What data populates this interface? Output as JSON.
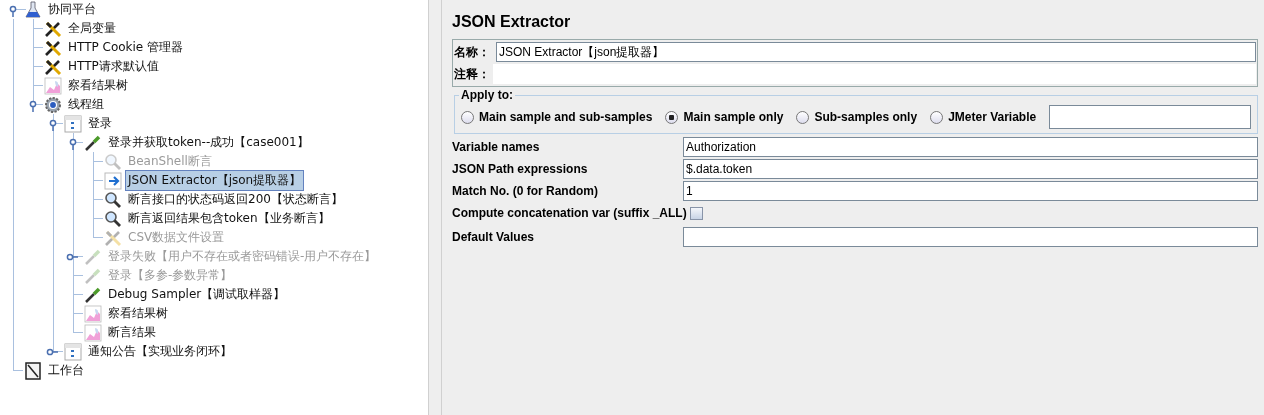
{
  "tree": [
    {
      "label": "协同平台",
      "kind": "testplan",
      "expanded": true,
      "disabled": false,
      "selected": false,
      "children": [
        {
          "label": "全局变量",
          "kind": "config",
          "disabled": false,
          "selected": false
        },
        {
          "label": "HTTP Cookie 管理器",
          "kind": "config",
          "disabled": false,
          "selected": false
        },
        {
          "label": "HTTP请求默认值",
          "kind": "config",
          "disabled": false,
          "selected": false
        },
        {
          "label": "察看结果树",
          "kind": "listener",
          "disabled": false,
          "selected": false
        },
        {
          "label": "线程组",
          "kind": "threadgroup",
          "expanded": true,
          "disabled": false,
          "selected": false,
          "children": [
            {
              "label": "登录",
              "kind": "controller",
              "expanded": true,
              "disabled": false,
              "selected": false,
              "children": [
                {
                  "label": "登录并获取token--成功【case001】",
                  "kind": "sampler",
                  "expanded": true,
                  "disabled": false,
                  "selected": false,
                  "children": [
                    {
                      "label": "BeanShell断言",
                      "kind": "assertion",
                      "disabled": true,
                      "selected": false
                    },
                    {
                      "label": "JSON Extractor【json提取器】",
                      "kind": "extractor",
                      "disabled": false,
                      "selected": true
                    },
                    {
                      "label": "断言接口的状态码返回200【状态断言】",
                      "kind": "assertion",
                      "disabled": false,
                      "selected": false
                    },
                    {
                      "label": "断言返回结果包含token【业务断言】",
                      "kind": "assertion",
                      "disabled": false,
                      "selected": false
                    },
                    {
                      "label": "CSV数据文件设置",
                      "kind": "config",
                      "disabled": true,
                      "selected": false
                    }
                  ]
                },
                {
                  "label": "登录失败【用户不存在或者密码错误-用户不存在】",
                  "kind": "sampler",
                  "expanded": false,
                  "disabled": true,
                  "selected": false
                },
                {
                  "label": "登录【多参-参数异常】",
                  "kind": "sampler",
                  "disabled": true,
                  "selected": false
                },
                {
                  "label": "Debug Sampler【调试取样器】",
                  "kind": "sampler",
                  "disabled": false,
                  "selected": false
                },
                {
                  "label": "察看结果树",
                  "kind": "listener",
                  "disabled": false,
                  "selected": false
                },
                {
                  "label": "断言结果",
                  "kind": "listener",
                  "disabled": false,
                  "selected": false
                }
              ]
            },
            {
              "label": "通知公告【实现业务闭环】",
              "kind": "controller",
              "expanded": false,
              "disabled": false,
              "selected": false
            }
          ]
        }
      ]
    },
    {
      "label": "工作台",
      "kind": "workbench",
      "disabled": false,
      "selected": false
    }
  ],
  "panel": {
    "title": "JSON Extractor",
    "name_label": "名称：",
    "name_value": "JSON Extractor【json提取器】",
    "comment_label": "注释：",
    "apply_to": {
      "legend": "Apply to:",
      "options": [
        {
          "label": "Main sample and sub-samples",
          "selected": false
        },
        {
          "label": "Main sample only",
          "selected": true
        },
        {
          "label": "Sub-samples only",
          "selected": false
        },
        {
          "label": "JMeter Variable",
          "selected": false
        }
      ]
    },
    "fields": [
      {
        "label": "Variable names",
        "kind": "text",
        "value": "Authorization"
      },
      {
        "label": "JSON Path expressions",
        "kind": "text",
        "value": "$.data.token"
      },
      {
        "label": "Match No. (0 for Random)",
        "kind": "text",
        "value": "1"
      },
      {
        "label": "Compute concatenation var (suffix _ALL)",
        "kind": "checkbox",
        "checked": false
      },
      {
        "label": "Default Values",
        "kind": "text"
      }
    ]
  }
}
